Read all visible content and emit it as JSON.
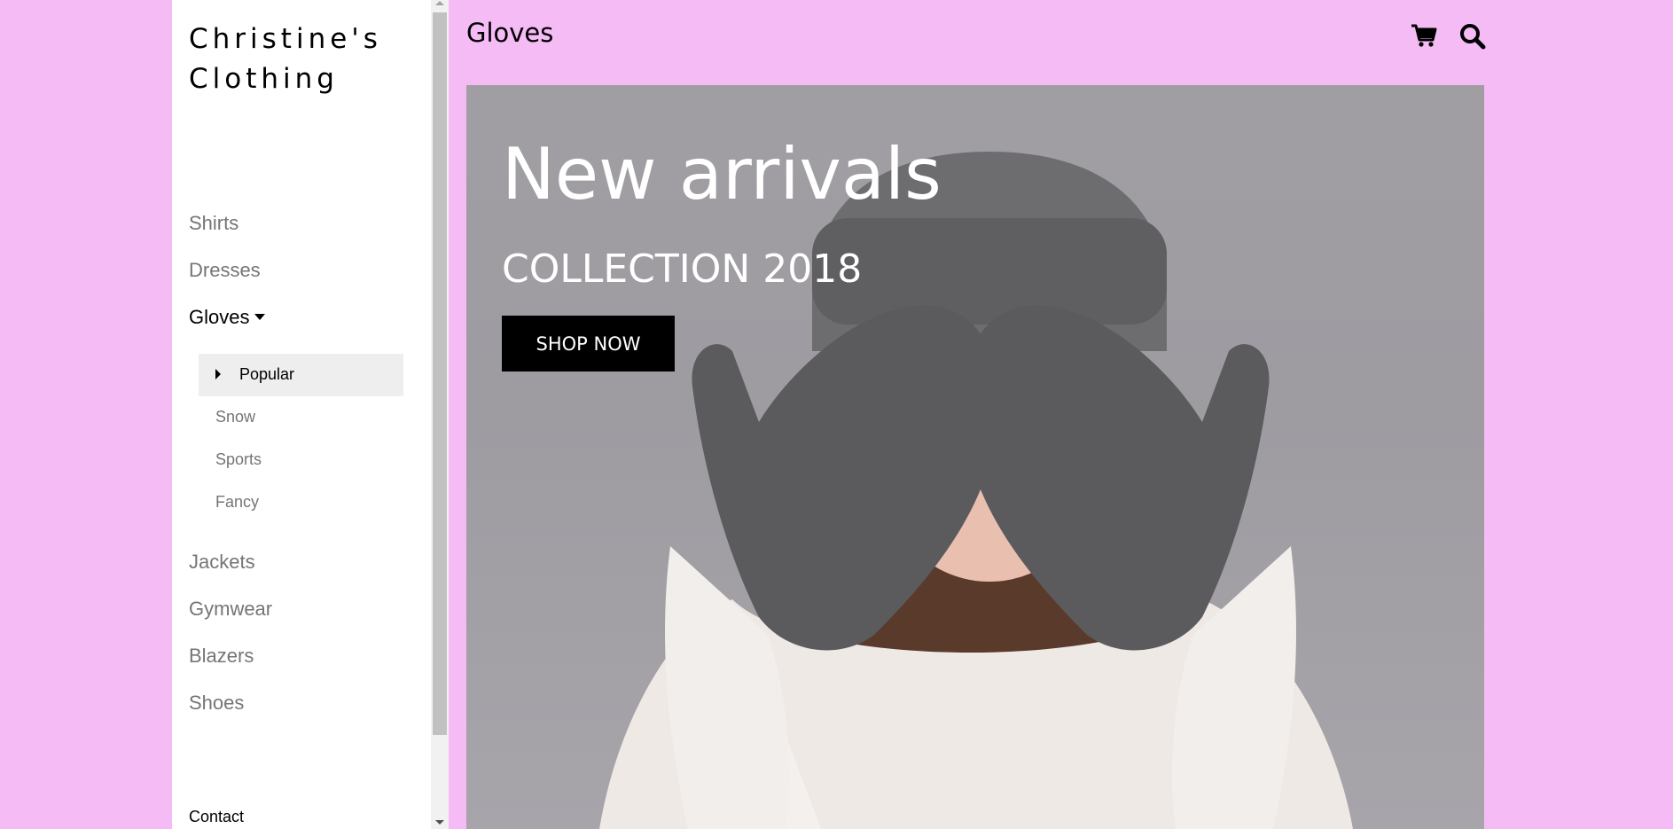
{
  "brand": {
    "line1": "Christine's",
    "line2": "Clothing"
  },
  "nav": {
    "items": [
      {
        "label": "Shirts"
      },
      {
        "label": "Dresses"
      },
      {
        "label": "Gloves"
      },
      {
        "label": "Jackets"
      },
      {
        "label": "Gymwear"
      },
      {
        "label": "Blazers"
      },
      {
        "label": "Shoes"
      }
    ],
    "gloves_submenu": [
      {
        "label": "Popular"
      },
      {
        "label": "Snow"
      },
      {
        "label": "Sports"
      },
      {
        "label": "Fancy"
      }
    ],
    "contact": "Contact"
  },
  "header": {
    "title": "Gloves",
    "icons": [
      "shopping-cart-icon",
      "search-icon"
    ]
  },
  "hero": {
    "title": "New arrivals",
    "subtitle": "COLLECTION 2018",
    "button_label": "SHOP NOW"
  },
  "colors": {
    "page_background": "#f5bbf5",
    "sidebar_background": "#ffffff",
    "nav_inactive": "#757575",
    "nav_active": "#000000",
    "submenu_active_background": "#eeeeee",
    "button_background": "#000000",
    "button_text": "#ffffff"
  }
}
